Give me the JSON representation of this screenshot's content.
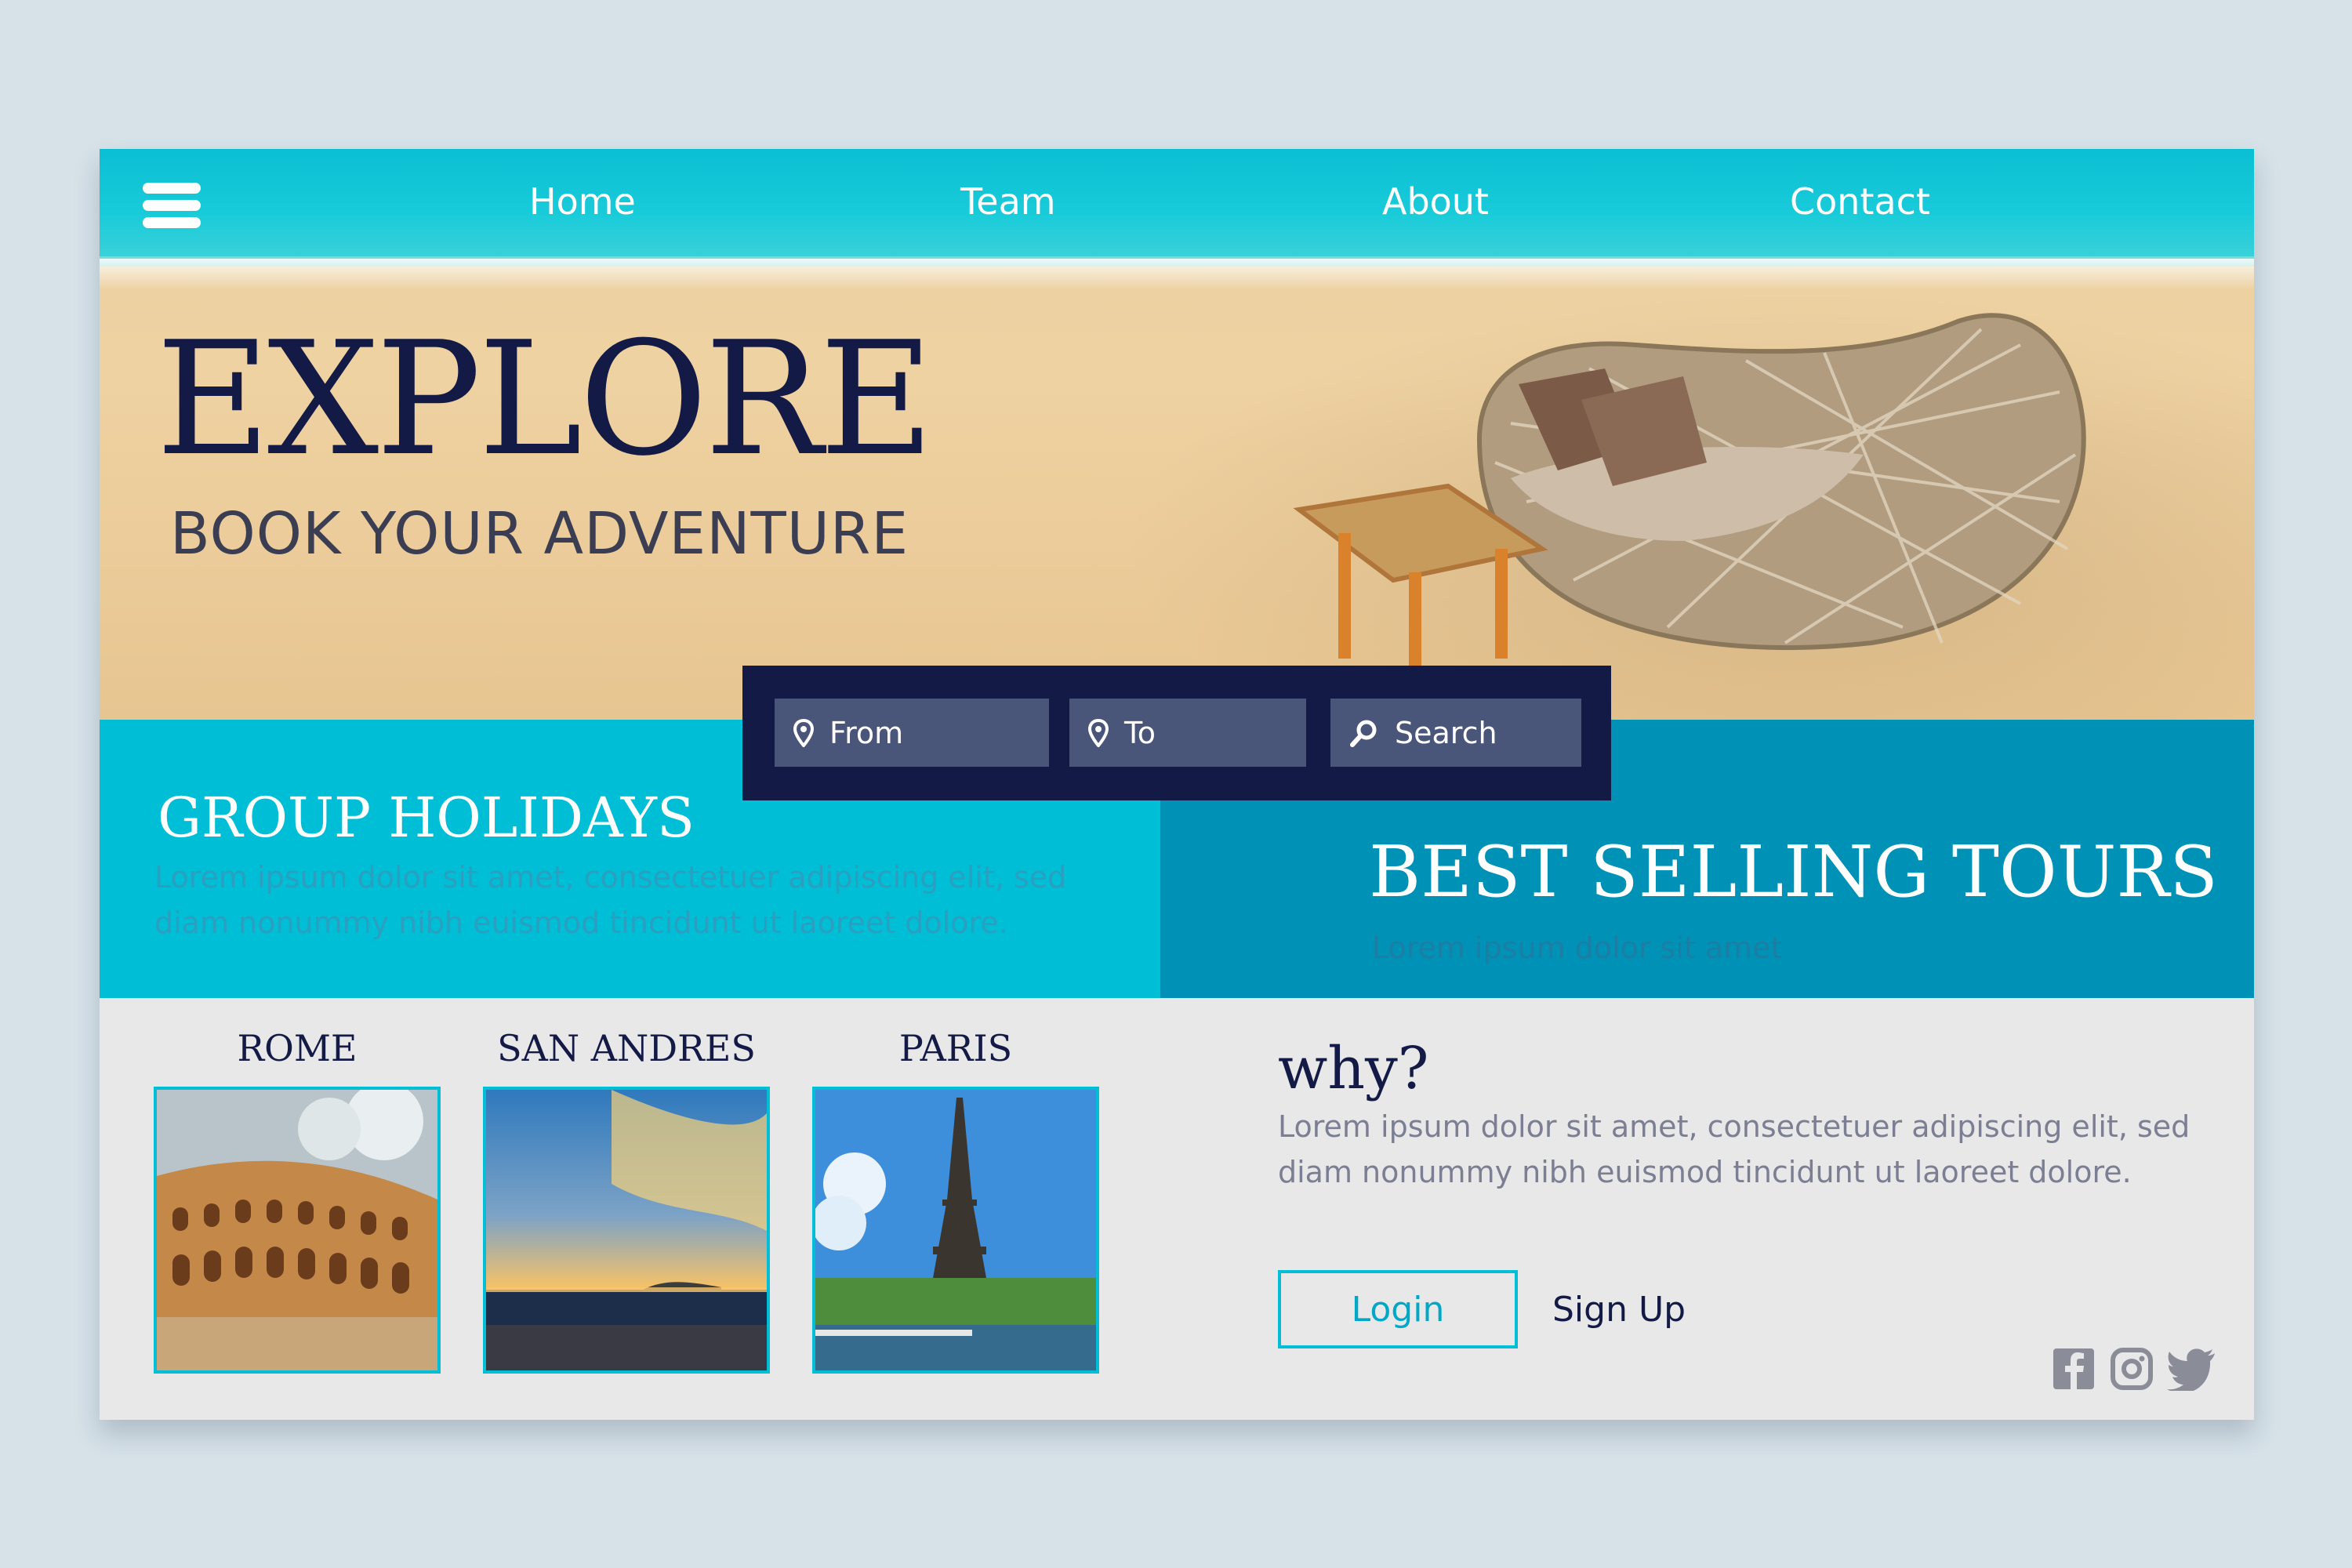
{
  "nav": {
    "items": [
      {
        "label": "Home"
      },
      {
        "label": "Team"
      },
      {
        "label": "About"
      },
      {
        "label": "Contact"
      }
    ],
    "menu_icon": "hamburger-menu-icon"
  },
  "hero": {
    "title": "EXPLORE",
    "subtitle": "BOOK YOUR ADVENTURE"
  },
  "search": {
    "from_label": "From",
    "to_label": "To",
    "search_label": "Search",
    "from_icon": "location-pin-icon",
    "to_icon": "location-pin-icon",
    "search_icon": "search-icon"
  },
  "group_holidays": {
    "title": "GROUP HOLIDAYS",
    "text_line1": "Lorem ipsum dolor sit amet, consectetuer adipiscing elit, sed",
    "text_line2": "diam nonummy nibh euismod tincidunt ut laoreet dolore."
  },
  "best_selling": {
    "title": "BEST SELLING TOURS",
    "text": "Lorem ipsum dolor sit amet"
  },
  "destinations": [
    {
      "name": "ROME"
    },
    {
      "name": "SAN ANDRES"
    },
    {
      "name": "PARIS"
    }
  ],
  "why": {
    "title": "why?",
    "text_line1": "Lorem ipsum dolor sit amet, consectetuer adipiscing elit, sed",
    "text_line2": "diam nonummy nibh euismod tincidunt ut laoreet dolore."
  },
  "auth": {
    "login_label": "Login",
    "signup_label": "Sign Up"
  },
  "social": [
    "facebook-icon",
    "instagram-icon",
    "twitter-icon"
  ],
  "colors": {
    "navy": "#131a45",
    "cyan": "#00bed5",
    "teal": "#0091b7",
    "page_bg": "#d6e1e8",
    "panel_bg": "#e8e8e8"
  }
}
